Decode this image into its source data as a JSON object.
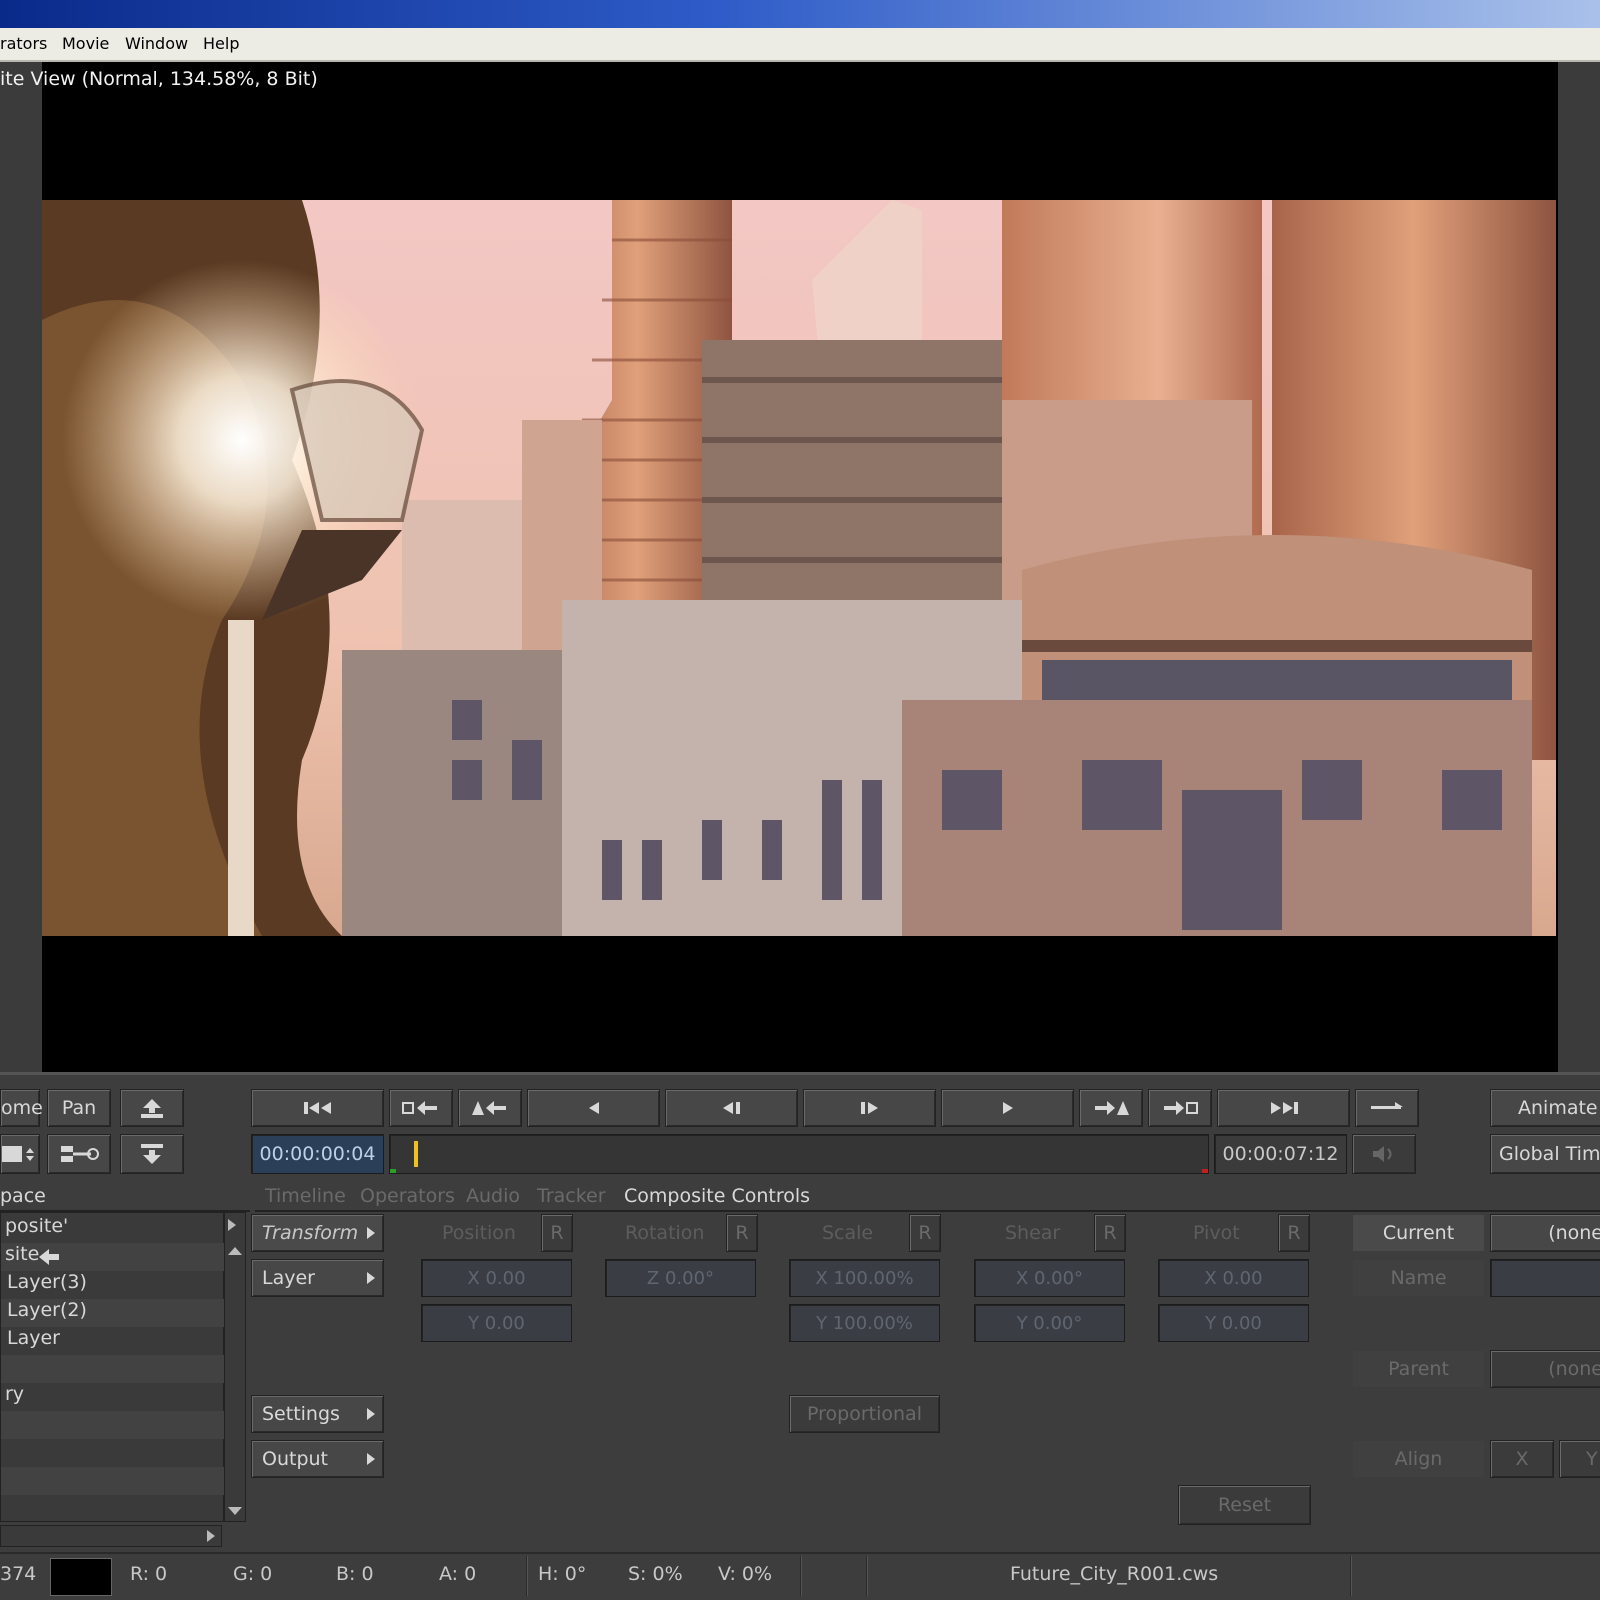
{
  "menu": {
    "items": [
      "rators",
      "Movie",
      "Window",
      "Help"
    ]
  },
  "viewer": {
    "title": "ite View (Normal, 134.58%, 8 Bit)"
  },
  "nav_buttons": {
    "home": "ome",
    "pan": "Pan"
  },
  "transport": {
    "current_time": "00:00:00:04",
    "end_time": "00:00:07:12",
    "playhead_fraction": 0.03
  },
  "right_buttons": {
    "animate": "Animate",
    "global_time": "Global Time"
  },
  "tabs": {
    "workspace": "pace",
    "items": [
      "Timeline",
      "Operators",
      "Audio",
      "Tracker",
      "Composite Controls"
    ]
  },
  "tree": {
    "rows": [
      "posite'",
      "site",
      "Layer(3)",
      "Layer(2)",
      "Layer",
      "",
      "ry",
      "",
      "",
      "",
      ""
    ]
  },
  "side_menu": {
    "transform": "Transform",
    "layer": "Layer",
    "settings": "Settings",
    "output": "Output"
  },
  "controls": {
    "position": {
      "label": "Position",
      "r": "R",
      "x": "X 0.00",
      "y": "Y 0.00"
    },
    "rotation": {
      "label": "Rotation",
      "r": "R",
      "z": "Z 0.00°"
    },
    "scale": {
      "label": "Scale",
      "r": "R",
      "x": "X 100.00%",
      "y": "Y 100.00%"
    },
    "shear": {
      "label": "Shear",
      "r": "R",
      "x": "X 0.00°",
      "y": "Y 0.00°"
    },
    "pivot": {
      "label": "Pivot",
      "r": "R",
      "x": "X 0.00",
      "y": "Y 0.00"
    },
    "proportional": "Proportional",
    "reset": "Reset"
  },
  "layer_props": {
    "current": "Current",
    "current_value": "(none",
    "name": "Name",
    "parent": "Parent",
    "parent_value": "(none",
    "align": "Align",
    "align_x": "X",
    "align_y": "Y"
  },
  "status": {
    "coord": "374",
    "swatch_color": "#000000",
    "r": "R: 0",
    "g": "G: 0",
    "b": "B: 0",
    "a": "A: 0",
    "h": "H: 0°",
    "s": "S: 0%",
    "v": "V: 0%",
    "file": "Future_City_R001.cws"
  }
}
